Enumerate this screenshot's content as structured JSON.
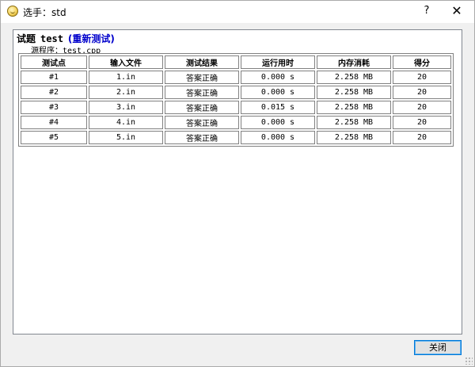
{
  "window": {
    "title": "选手：std",
    "help_label": "?",
    "close_label": "✕"
  },
  "problem": {
    "label": "试题",
    "name": "test",
    "rejudge_label": "(重新测试)",
    "source_label": "源程序：",
    "source_file": "test.cpp"
  },
  "table": {
    "headers": [
      "测试点",
      "输入文件",
      "测试结果",
      "运行用时",
      "内存消耗",
      "得分"
    ],
    "rows": [
      [
        "#1",
        "1.in",
        "答案正确",
        "0.000 s",
        "2.258 MB",
        "20"
      ],
      [
        "#2",
        "2.in",
        "答案正确",
        "0.000 s",
        "2.258 MB",
        "20"
      ],
      [
        "#3",
        "3.in",
        "答案正确",
        "0.015 s",
        "2.258 MB",
        "20"
      ],
      [
        "#4",
        "4.in",
        "答案正确",
        "0.000 s",
        "2.258 MB",
        "20"
      ],
      [
        "#5",
        "5.in",
        "答案正确",
        "0.000 s",
        "2.258 MB",
        "20"
      ]
    ]
  },
  "footer": {
    "close_label": "关闭"
  },
  "colors": {
    "link": "#0000cc",
    "focus_border": "#0078d7"
  }
}
